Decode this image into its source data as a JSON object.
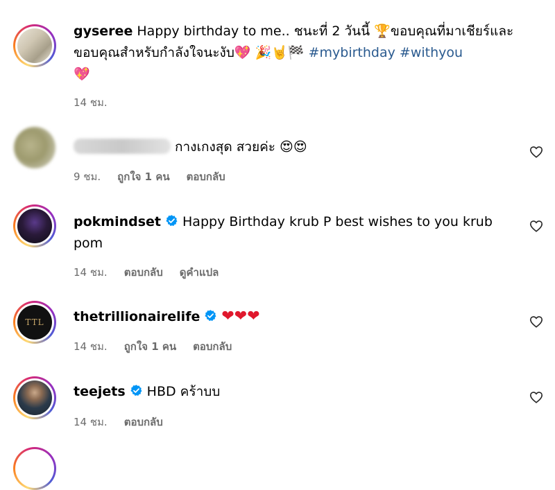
{
  "comments": [
    {
      "username": "gyseree",
      "text": "Happy birthday to me.. ชนะที่ 2 วันนี้ 🏆ขอบคุณที่มาเชียร์และขอบคุณสำหรับกำลังใจนะงับ💖 🎉🤘🏁 ",
      "hashtags": [
        "#mybirthday",
        "#withyou"
      ],
      "trailing_emoji": "💖",
      "time": "14 ชม.",
      "actions": []
    },
    {
      "username": "",
      "text": "กางเกงสุด สวยค่ะ 😍😍",
      "time": "9 ชม.",
      "actions": [
        "ถูกใจ 1 คน",
        "ตอบกลับ"
      ]
    },
    {
      "username": "pokmindset",
      "text": "Happy Birthday krub P best wishes to you krub pom",
      "time": "14 ชม.",
      "actions": [
        "ตอบกลับ",
        "ดูคำแปล"
      ]
    },
    {
      "username": "thetrillionairelife",
      "text": "❤❤❤",
      "time": "14 ชม.",
      "actions": [
        "ถูกใจ 1 คน",
        "ตอบกลับ"
      ]
    },
    {
      "username": "teejets",
      "text": "HBD คร้าบบ",
      "time": "14 ชม.",
      "actions": [
        "ตอบกลับ"
      ]
    }
  ],
  "colors": {
    "hashtag": "#2a5a8f",
    "verified": "#0095f6",
    "meta": "#6b6b6b"
  }
}
